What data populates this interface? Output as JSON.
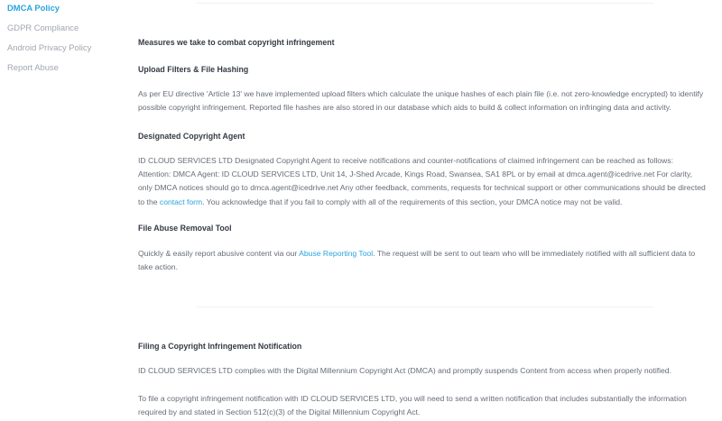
{
  "sidebar": {
    "items": [
      {
        "label": "DMCA Policy",
        "active": true
      },
      {
        "label": "GDPR Compliance",
        "active": false
      },
      {
        "label": "Android Privacy Policy",
        "active": false
      },
      {
        "label": "Report Abuse",
        "active": false
      }
    ]
  },
  "sections": {
    "measures": {
      "heading": "Measures we take to combat copyright infringement"
    },
    "upload_filters": {
      "heading": "Upload Filters & File Hashing",
      "body": "As per EU directive 'Article 13' we have implemented upload filters which calculate the unique hashes of each plain file (i.e. not zero-knowledge encrypted) to identify possible copyright infringement. Reported file hashes are also stored in our database which aids to build & collect information on infringing data and activity."
    },
    "agent": {
      "heading": "Designated Copyright Agent",
      "body_before": "ID CLOUD SERVICES LTD Designated Copyright Agent to receive notifications and counter-notifications of claimed infringement can be reached as follows: Attention: DMCA Agent: ID CLOUD SERVICES LTD, Unit 14, J-Shed Arcade, Kings Road, Swansea, SA1 8PL or by email at dmca.agent@icedrive.net For clarity, only DMCA notices should go to dmca.agent@icedrive.net Any other feedback, comments, requests for technical support or other communications should be directed to the ",
      "link": "contact form",
      "body_after": ". You acknowledge that if you fail to comply with all of the requirements of this section, your DMCA notice may not be valid."
    },
    "abuse_tool": {
      "heading": "File Abuse Removal Tool",
      "body_before": "Quickly & easily report abusive content via our ",
      "link": "Abuse Reporting Tool",
      "body_after": ". The request will be sent to out team who will be immediately notified with all sufficient data to take action."
    },
    "filing": {
      "heading": "Filing a Copyright Infringement Notification",
      "body1": "ID CLOUD SERVICES LTD complies with the Digital Millennium Copyright Act (DMCA) and promptly suspends Content from access when properly notified.",
      "body2": "To file a copyright infringement notification with ID CLOUD SERVICES LTD, you will need to send a written notification that includes substantially the information required by and stated in Section 512(c)(3) of the Digital Millennium Copyright Act."
    }
  }
}
